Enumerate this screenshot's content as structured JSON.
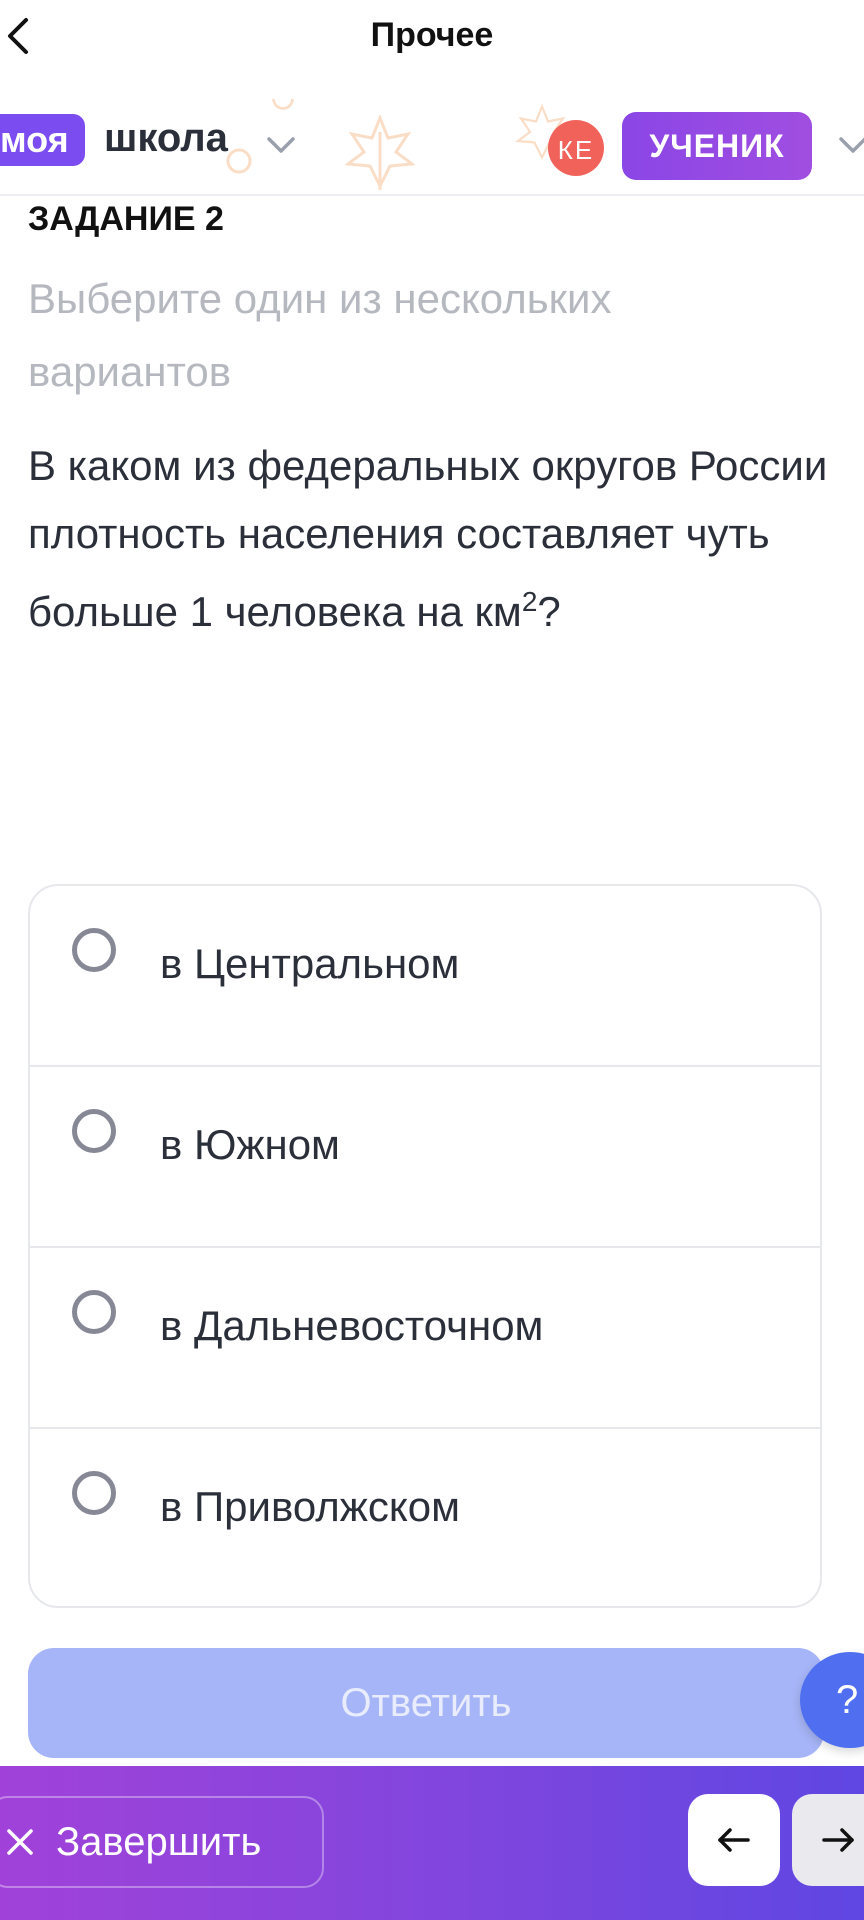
{
  "nav": {
    "title": "Прочее"
  },
  "header": {
    "logo_part1": "моя",
    "logo_part2": "школа",
    "avatar_initials": "КЕ",
    "role_label": "УЧЕНИК"
  },
  "task": {
    "label": "ЗАДАНИЕ 2",
    "hint": "Выберите один из нескольких вариантов",
    "question_text": "В каком из федеральных округов России плотность населения составляет чуть больше 1 человека на км",
    "question_superscript": "2",
    "question_end": "?"
  },
  "options": [
    {
      "label": "в Центральном"
    },
    {
      "label": "в Южном"
    },
    {
      "label": "в Дальневосточном"
    },
    {
      "label": "в Приволжском"
    }
  ],
  "answer_button": "Ответить",
  "help_button": "?",
  "bottom": {
    "finish_label": "Завершить"
  },
  "colors": {
    "accent_purple": "#7b4df1",
    "answer_disabled": "#a6b5f7",
    "help_blue": "#4f6ff0",
    "avatar_red": "#f0625a"
  }
}
